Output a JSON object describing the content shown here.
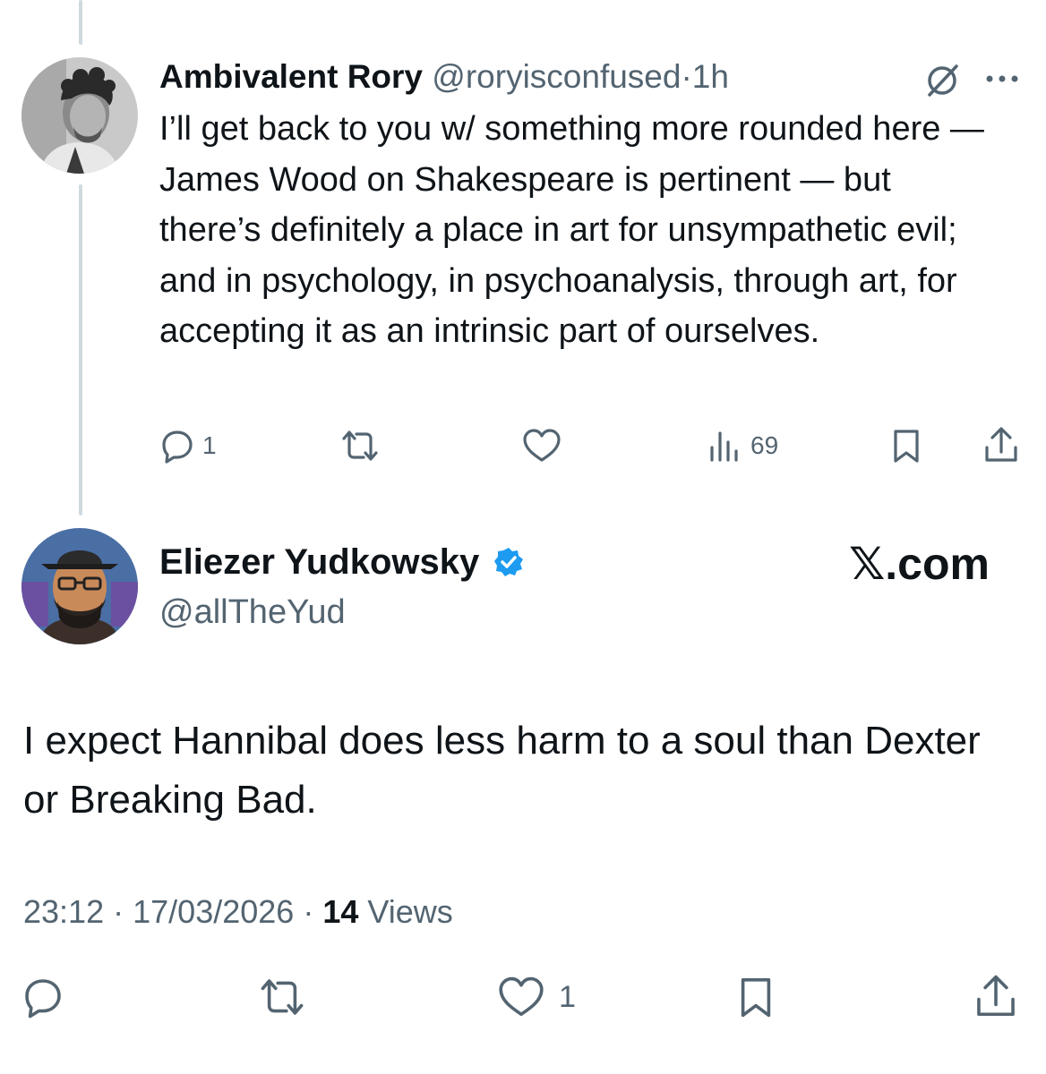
{
  "reply_tweet": {
    "author_name": "Ambivalent Rory",
    "author_handle": "@roryisconfused",
    "separator": "·",
    "time": "1h",
    "text": "I’ll get back to you w/ something more rounded here — James Wood on Shakespeare is pertinent — but there’s definitely a place in art for unsympathetic evil; and in psychology, in psychoanalysis, through art, for accepting it as an intrinsic part of ourselves.",
    "actions": {
      "reply_count": "1",
      "views_count": "69"
    },
    "icons": [
      "grok-icon",
      "more-icon",
      "reply-icon",
      "retweet-icon",
      "like-icon",
      "views-icon",
      "bookmark-icon",
      "share-icon"
    ]
  },
  "main_tweet": {
    "author_name": "Eliezer Yudkowsky",
    "author_handle": "@allTheYud",
    "verified": true,
    "text": "I expect Hannibal does less harm to a soul than Dexter or Breaking Bad.",
    "time": "23:12",
    "date": "17/03/2026",
    "separator": "·",
    "views_count": "14",
    "views_label": "Views",
    "actions": {
      "like_count": "1"
    }
  },
  "watermark": "𝕏.com",
  "colors": {
    "text": "#0f1419",
    "secondary": "#536471",
    "thread_line": "#cfd9de",
    "verified_badge": "#1d9bf0"
  }
}
